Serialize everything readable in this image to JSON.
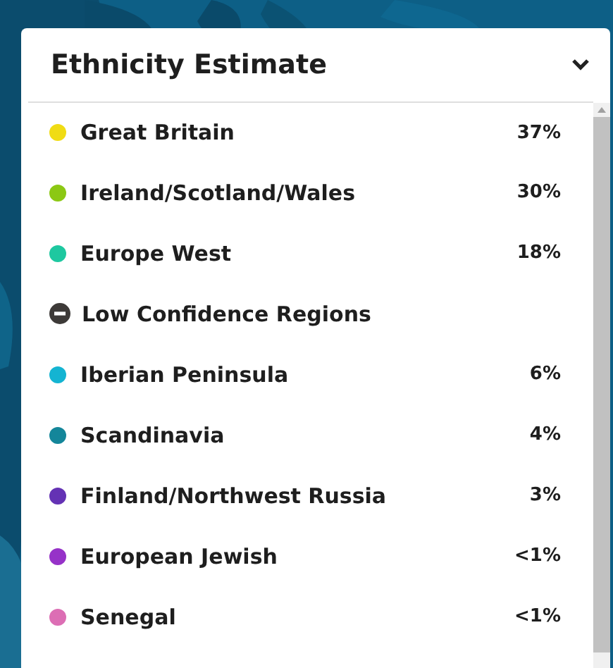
{
  "panel": {
    "title": "Ethnicity Estimate",
    "expanded": true
  },
  "items": [
    {
      "kind": "region",
      "name": "Great Britain",
      "percent": "37%",
      "color": "#f0dc14"
    },
    {
      "kind": "region",
      "name": "Ireland/Scotland/Wales",
      "percent": "30%",
      "color": "#8cc814"
    },
    {
      "kind": "region",
      "name": "Europe West",
      "percent": "18%",
      "color": "#1ec8a0"
    },
    {
      "kind": "group",
      "name": "Low Confidence Regions"
    },
    {
      "kind": "region",
      "name": "Iberian Peninsula",
      "percent": "6%",
      "color": "#14b4d2"
    },
    {
      "kind": "region",
      "name": "Scandinavia",
      "percent": "4%",
      "color": "#14869a"
    },
    {
      "kind": "region",
      "name": "Finland/Northwest Russia",
      "percent": "3%",
      "color": "#6432b4"
    },
    {
      "kind": "region",
      "name": "European Jewish",
      "percent": "<1%",
      "color": "#9632c8"
    },
    {
      "kind": "region",
      "name": "Senegal",
      "percent": "<1%",
      "color": "#dc6eb4"
    }
  ]
}
